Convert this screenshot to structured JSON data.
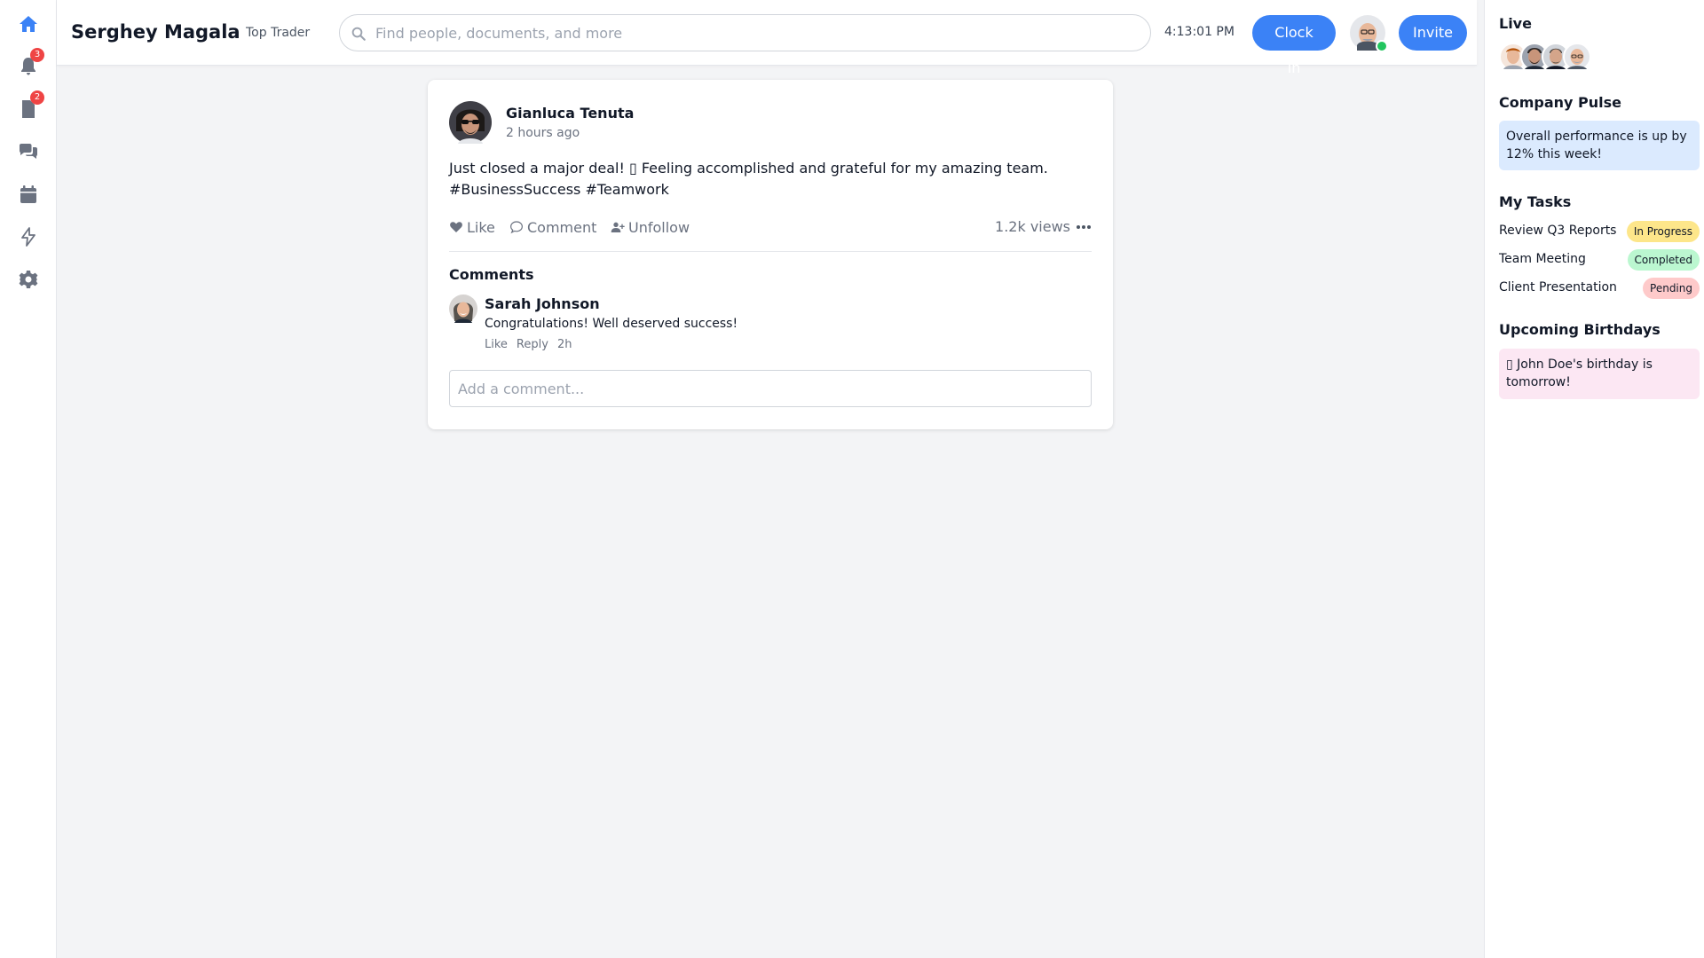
{
  "colors": {
    "accent": "#3b82f6",
    "badge": "#ef4444",
    "online": "#22c55e",
    "pulse_bg": "#dbeafe",
    "birthday_bg": "#fce7f3",
    "status_in_progress": "#fde68a",
    "status_completed": "#bbf7d0",
    "status_pending": "#fecaca"
  },
  "rail": {
    "items": [
      {
        "icon": "home-icon",
        "active": true
      },
      {
        "icon": "bell-icon",
        "badge": "3"
      },
      {
        "icon": "document-icon",
        "badge": "2"
      },
      {
        "icon": "chat-icon"
      },
      {
        "icon": "calendar-icon"
      },
      {
        "icon": "bolt-icon"
      },
      {
        "icon": "gear-icon"
      }
    ]
  },
  "header": {
    "user_name": "Serghey Magala",
    "user_role": "Top Trader",
    "search_placeholder": "Find people, documents, and more",
    "clock": "4:13:01 PM",
    "clock_in_label": "Clock In",
    "invite_label": "Invite"
  },
  "post": {
    "author": "Gianluca Tenuta",
    "time": "2 hours ago",
    "text": "Just closed a major deal! ▯ Feeling accomplished and grateful for my amazing team. #BusinessSuccess #Teamwork",
    "like_label": "Like",
    "comment_label": "Comment",
    "unfollow_label": "Unfollow",
    "views": "1.2k views",
    "comments_title": "Comments",
    "comments": [
      {
        "author": "Sarah Johnson",
        "text": "Congratulations! Well deserved success!",
        "like_label": "Like",
        "reply_label": "Reply",
        "time": "2h"
      }
    ],
    "comment_placeholder": "Add a comment..."
  },
  "sidebar": {
    "live_title": "Live",
    "pulse_title": "Company Pulse",
    "pulse_text": "Overall performance is up by 12% this week!",
    "tasks_title": "My Tasks",
    "tasks": [
      {
        "name": "Review Q3 Reports",
        "status": "In Progress"
      },
      {
        "name": "Team Meeting",
        "status": "Completed"
      },
      {
        "name": "Client Presentation",
        "status": "Pending"
      }
    ],
    "birthdays_title": "Upcoming Birthdays",
    "birthday_text": "▯ John Doe's birthday is tomorrow!"
  }
}
